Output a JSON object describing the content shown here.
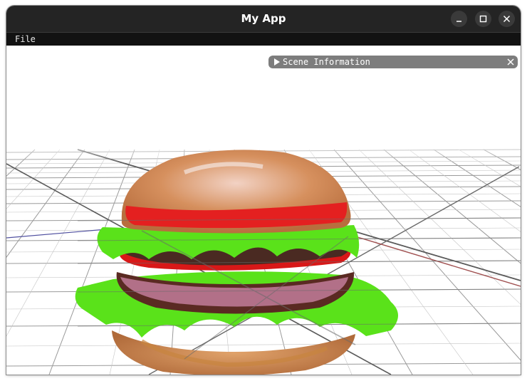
{
  "window": {
    "title": "My App",
    "controls": [
      "minimize-icon",
      "maximize-icon",
      "close-icon"
    ]
  },
  "menu": {
    "items": [
      {
        "label": "File"
      }
    ]
  },
  "scene_panel": {
    "title": "Scene Information",
    "collapsed": true,
    "expand_icon": "triangle-right-icon",
    "close_icon": "close-icon"
  },
  "colors": {
    "titlebar": "#242424",
    "menubar": "#121212",
    "panel_header": "#7d7d7d",
    "axis_x": "#a05050",
    "axis_z": "#5050a0",
    "grid": "#9a9a9a"
  }
}
